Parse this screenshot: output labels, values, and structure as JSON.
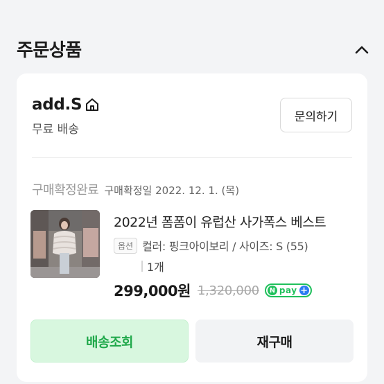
{
  "section": {
    "title": "주문상품"
  },
  "order": {
    "shop_name": "add.S",
    "shipping": "무료 배송",
    "inquiry_label": "문의하기",
    "status": "구매확정완료",
    "status_detail": "구매확정일 2022. 12. 1. (목)",
    "product": {
      "title": "2022년 폼폼이 유럽산 사가폭스 베스트",
      "option_badge": "옵션",
      "option_text": "컬러: 핑크아이보리 / 사이즈: S (55)",
      "quantity": "1개",
      "price": "299,000원",
      "original_price": "1,320,000",
      "pay_badge": {
        "n": "N",
        "text": "pay",
        "plus": "+"
      }
    },
    "buttons": {
      "track": "배송조회",
      "rebuy": "재구매"
    }
  },
  "colors": {
    "accent_green": "#1fa84a",
    "track_bg": "#d8f7df",
    "npay_green": "#20c05c",
    "npay_blue": "#2a7cf2"
  }
}
